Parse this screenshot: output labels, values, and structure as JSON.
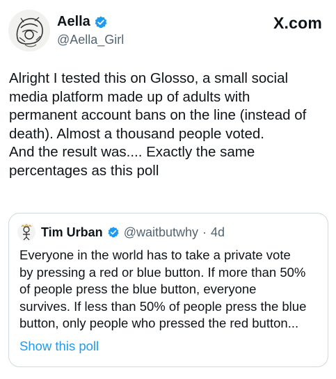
{
  "header": {
    "site_label": "X.com",
    "author": {
      "name": "Aella",
      "handle": "@Aella_Girl",
      "verified": true
    }
  },
  "tweet": {
    "text": "Alright I tested this on Glosso, a small social\nmedia platform made up of adults with\npermanent account bans on the line (instead of\ndeath). Almost a thousand people voted.\nAnd the result was.... Exactly the same\npercentages as this poll"
  },
  "quote": {
    "author": {
      "name": "Tim Urban",
      "handle": "@waitbutwhy",
      "separator": "·",
      "time": "4d",
      "verified": true
    },
    "text": "Everyone in the world has to take a private vote\nby pressing a red or blue button. If more than 50%\nof people press the blue button, everyone\nsurvives. If less than 50% of people press the blue\nbutton, only people who pressed the red button...",
    "link_label": "Show this poll"
  },
  "colors": {
    "text": "#0f1419",
    "muted": "#536471",
    "link": "#1d9bf0",
    "border": "#cfd9de",
    "verified": "#1d9bf0"
  },
  "icons": {
    "verified": "verified-badge-icon",
    "avatar": "sketch-avatar"
  }
}
